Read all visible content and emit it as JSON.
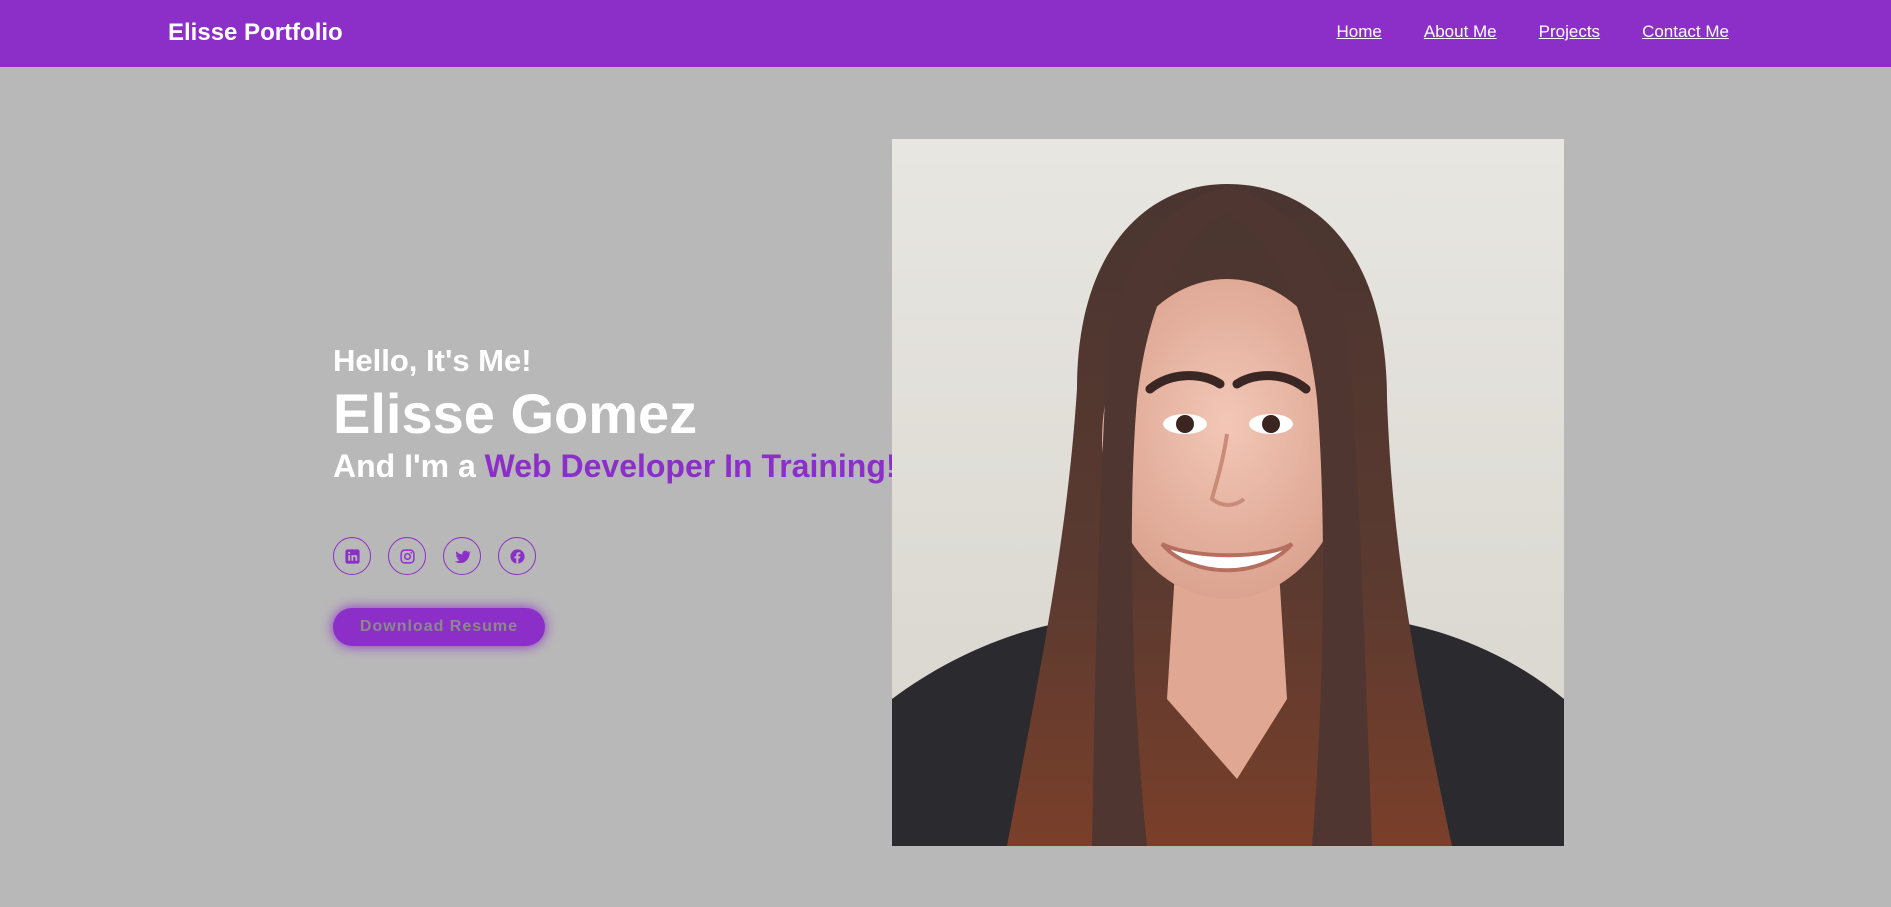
{
  "nav": {
    "logo": "Elisse Portfolio",
    "links": [
      "Home",
      "About Me",
      "Projects",
      "Contact Me"
    ]
  },
  "hero": {
    "greeting": "Hello, It's Me!",
    "name": "Elisse Gomez",
    "tagline_prefix": "And I'm a ",
    "tagline_role": "Web Developer In Training!",
    "resume_button": "Download Resume",
    "socials": [
      "linkedin-icon",
      "instagram-icon",
      "twitter-icon",
      "facebook-icon"
    ]
  },
  "colors": {
    "accent": "#8c2fc9",
    "background": "#b8b8b8",
    "text": "#ffffff"
  }
}
